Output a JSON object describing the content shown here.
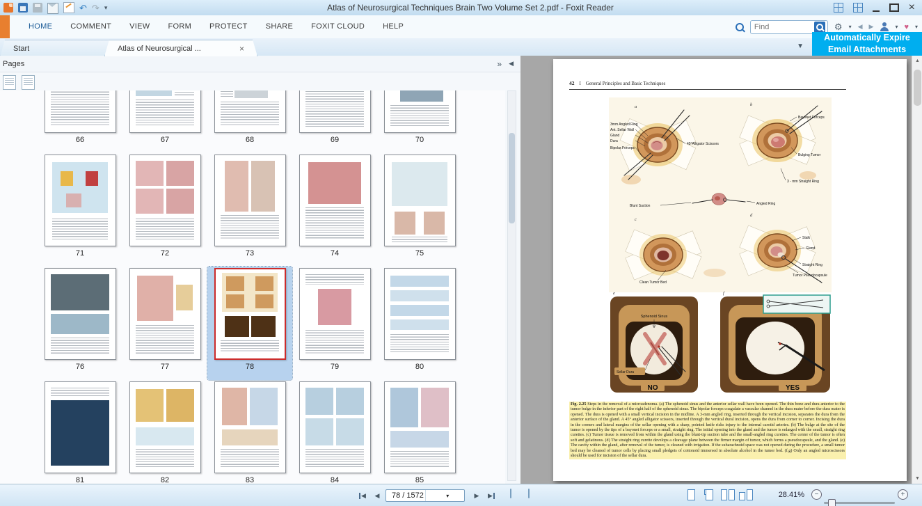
{
  "window": {
    "title": "Atlas of Neurosurgical Techniques Brain Two Volume Set 2.pdf - Foxit Reader"
  },
  "ribbon": {
    "tabs": [
      "HOME",
      "COMMENT",
      "VIEW",
      "FORM",
      "PROTECT",
      "SHARE",
      "FOXIT CLOUD",
      "HELP"
    ],
    "find_placeholder": "Find"
  },
  "doc_tabs": [
    {
      "label": "Start"
    },
    {
      "label": "Atlas of Neurosurgical ..."
    }
  ],
  "banner": {
    "line1": "Automatically Expire",
    "line2": "Email Attachments",
    "color": "#00aeef"
  },
  "pages_panel": {
    "title": "Pages",
    "pages": [
      66,
      67,
      68,
      69,
      70,
      71,
      72,
      73,
      74,
      75,
      76,
      77,
      78,
      79,
      80,
      81,
      82,
      83,
      84,
      85
    ],
    "selected_page": 78
  },
  "document": {
    "page_header": {
      "number": "42",
      "part": "I",
      "title": "General Principles and Basic Techniques"
    },
    "figure": {
      "letters": [
        "a",
        "b",
        "c",
        "d",
        "e",
        "f"
      ],
      "labels": {
        "angled_ring_3mm": "3mm Angled Ring",
        "ant_sellar_wall": "Ant. Sellar Wall",
        "gland_a": "Gland",
        "dura": "Dura",
        "bipolar_forceps": "Bipolar Forceps",
        "alligator_scissors": "45°Alligator Scissors",
        "bayonet_forceps": "Bayonet Forceps",
        "bulging_tumor": "Bulging Tumor",
        "straight_ring_3mm": "3 - mm Straight Ring",
        "blunt_suction": "Blunt Suction",
        "angled_ring": "Angled Ring",
        "stalk": "Stalk",
        "gland_d": "Gland",
        "straight_ring": "Straight Ring",
        "tumor_pseudocapsule": "Tumor Pseudocapsule",
        "clean_tumor_bed": "Clean Tumor Bed",
        "sphenoid_sinus": "Sphenoid Sinus",
        "sellar_dura": "Sellar Dura",
        "no": "NO",
        "yes": "YES"
      }
    },
    "caption": {
      "label": "Fig. 2.25",
      "text": "Steps in the removal of a microadenoma. (a) The sphenoid sinus and the anterior sellar wall have been opened. The thin bone and dura anterior to the tumor bulge in the inferior part of the right half of the sphenoid sinus. The bipolar forceps coagulate a vascular channel in the dura mater before the dura mater is opened. The dura is opened with a small vertical incision in the midline. A 3-mm angled ring, inserted through the vertical incision, separates the dura from the anterior surface of the gland. A 45° angled alligator scissors, inserted through the vertical dural incision, opens the dura from corner to corner. Incising the dura in the corners and lateral margins of the sellar opening with a sharp, pointed knife risks injury to the internal carotid arteries. (b) The bulge at the site of the tumor is opened by the tips of a bayonet forceps or a small, straight ring. The initial opening into the gland and the tumor is enlarged with the small, straight ring curettes. (c) Tumor tissue is removed from within the gland using the blunt-tip suction tube and the small-angled ring curettes. The center of the tumor is often soft and gelatinous. (d) The straight ring curette develops a cleavage plane between the firmer margin of tumor, which forms a pseudocapsule, and the gland. (e) The cavity within the gland, after removal of the tumor, is cleaned with irrigation. If the subarachnoid space was not opened during the procedure, a small tumor bed may be cleaned of tumor cells by placing small pledgets of cottonoid immersed in absolute alcohol in the tumor bed. (f,g) Only an angled microscissors should be used for incision of the sellar dura."
    }
  },
  "status_bar": {
    "page_field": "78 / 1572",
    "zoom": "28.41%"
  }
}
